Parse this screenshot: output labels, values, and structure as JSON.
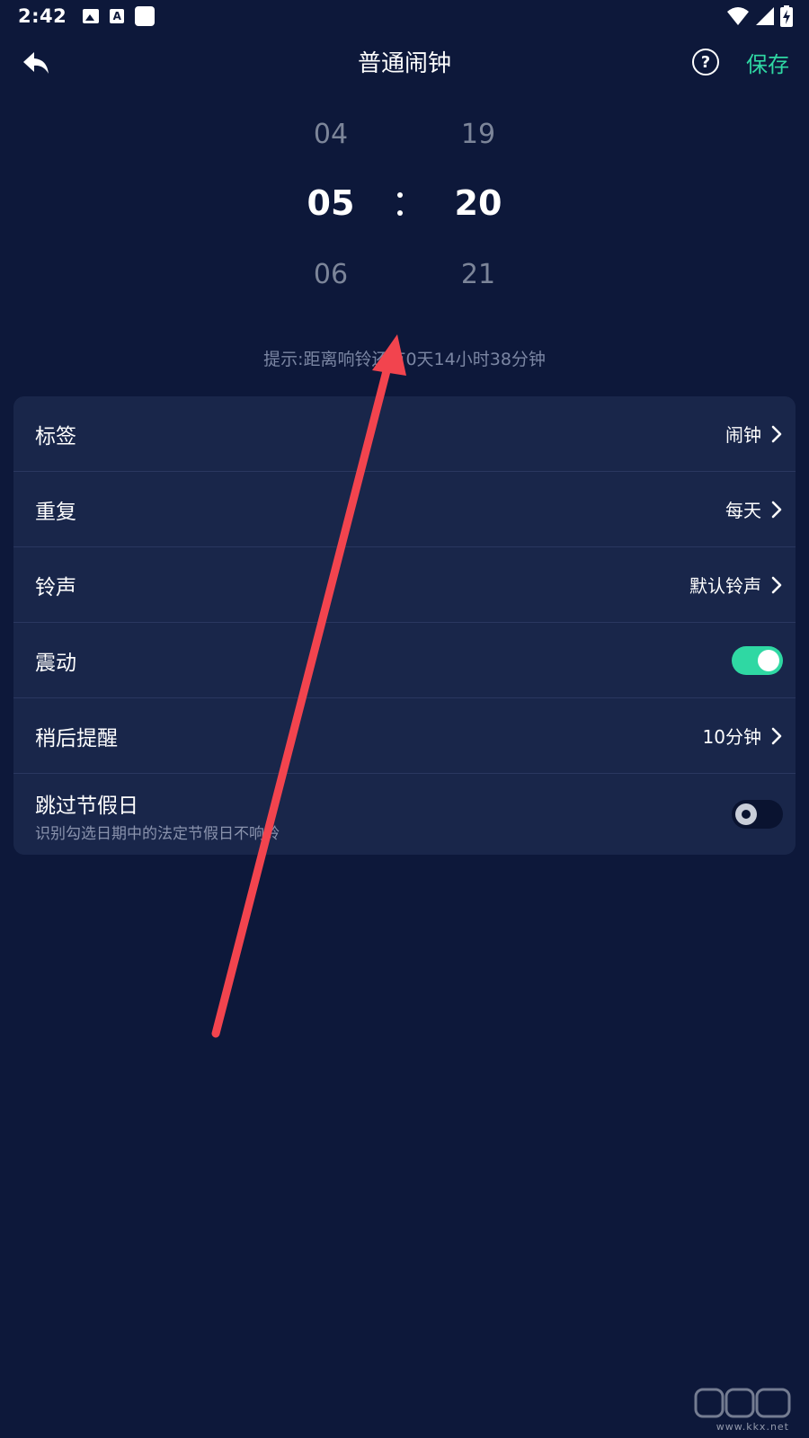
{
  "status_bar": {
    "time": "2:42",
    "a_icon_letter": "A"
  },
  "header": {
    "title": "普通闹钟",
    "help_symbol": "?",
    "save_label": "保存"
  },
  "picker": {
    "hours": {
      "prev": "04",
      "selected": "05",
      "next": "06"
    },
    "minutes": {
      "prev": "19",
      "selected": "20",
      "next": "21"
    }
  },
  "hint": "提示:距离响铃还有0天14小时38分钟",
  "settings": {
    "label": {
      "title": "标签",
      "value": "闹钟"
    },
    "repeat": {
      "title": "重复",
      "value": "每天"
    },
    "ringtone": {
      "title": "铃声",
      "value": "默认铃声"
    },
    "vibrate": {
      "title": "震动",
      "on": true
    },
    "snooze": {
      "title": "稍后提醒",
      "value": "10分钟"
    },
    "skip_holidays": {
      "title": "跳过节假日",
      "subtitle": "识别勾选日期中的法定节假日不响铃",
      "on": false
    }
  },
  "colors": {
    "background": "#0d183a",
    "card": "#19264a",
    "accent": "#2fd8a3",
    "arrow": "#f2444e"
  },
  "watermark": {
    "text": "www.kkx.net"
  }
}
